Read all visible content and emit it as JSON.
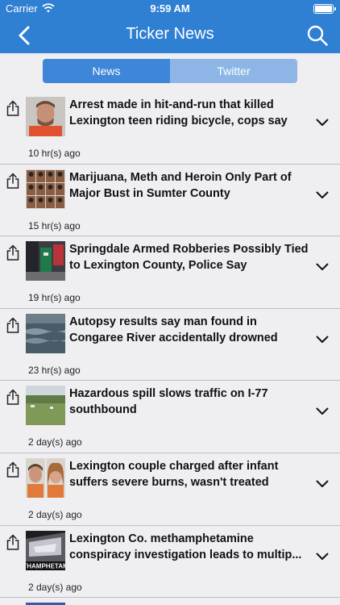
{
  "status_bar": {
    "carrier": "Carrier",
    "time": "9:59 AM",
    "icons": [
      "wifi-icon",
      "battery-icon"
    ]
  },
  "nav": {
    "title": "Ticker News",
    "back_icon": "chevron-left-icon",
    "search_icon": "search-icon"
  },
  "segments": {
    "news": "News",
    "twitter": "Twitter",
    "selected": "News"
  },
  "colors": {
    "nav_bg": "#2f7fd3",
    "segment_active": "#3d86d8",
    "segment_inactive": "#8db6e6",
    "list_bg": "#efeff2"
  },
  "articles": [
    {
      "headline": "Arrest made in hit-and-run that killed Lexington teen riding bicycle, cops say",
      "time": "10 hr(s) ago"
    },
    {
      "headline": "Marijuana, Meth and Heroin Only Part of Major Bust in Sumter County",
      "time": "15 hr(s) ago"
    },
    {
      "headline": "Springdale Armed Robberies Possibly Tied to Lexington County, Police Say",
      "time": "19 hr(s) ago"
    },
    {
      "headline": "Autopsy results say man found in Congaree River accidentally drowned",
      "time": "23 hr(s) ago"
    },
    {
      "headline": "Hazardous spill slows traffic on I-77 southbound",
      "time": "2 day(s) ago"
    },
    {
      "headline": "Lexington couple charged after infant suffers severe burns, wasn't treated",
      "time": "2 day(s) ago"
    },
    {
      "headline": "Lexington Co. methamphetamine conspiracy investigation leads to multip...",
      "time": "2 day(s) ago",
      "thumb_caption": "THAMPHETAM"
    }
  ]
}
